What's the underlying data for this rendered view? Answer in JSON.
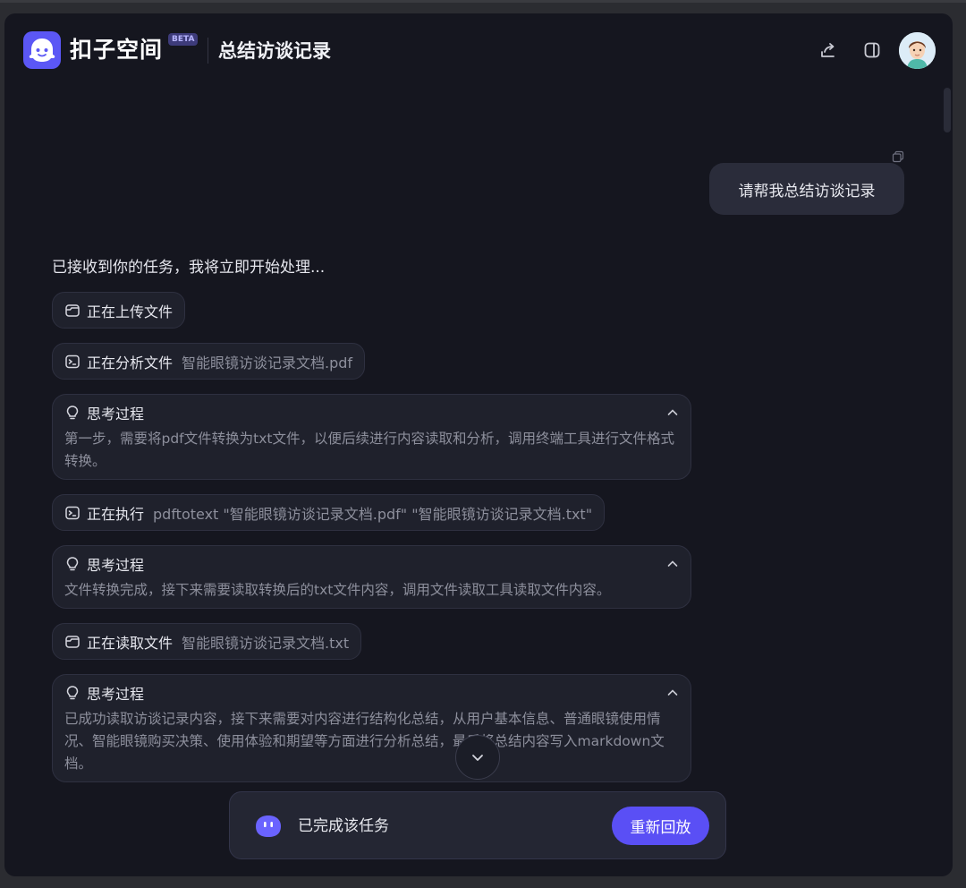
{
  "app": {
    "brand": "扣子空间",
    "badge": "BETA",
    "title": "总结访谈记录"
  },
  "header_icons": [
    "share-icon",
    "sidebar-toggle-icon",
    "avatar"
  ],
  "user_message": "请帮我总结访谈记录",
  "assistant": {
    "intro": "已接收到你的任务，我将立即开始处理...",
    "steps": [
      {
        "type": "pill",
        "icon": "folder-icon",
        "label": "正在上传文件",
        "detail": ""
      },
      {
        "type": "pill",
        "icon": "terminal-icon",
        "label": "正在分析文件",
        "detail": "智能眼镜访谈记录文档.pdf"
      },
      {
        "type": "think",
        "icon": "lightbulb-icon",
        "label": "思考过程",
        "body": "第一步，需要将pdf文件转换为txt文件，以便后续进行内容读取和分析，调用终端工具进行文件格式转换。"
      },
      {
        "type": "pill",
        "icon": "terminal-icon",
        "label": "正在执行",
        "detail": "pdftotext \"智能眼镜访谈记录文档.pdf\" \"智能眼镜访谈记录文档.txt\""
      },
      {
        "type": "think",
        "icon": "lightbulb-icon",
        "label": "思考过程",
        "body": "文件转换完成，接下来需要读取转换后的txt文件内容，调用文件读取工具读取文件内容。"
      },
      {
        "type": "pill",
        "icon": "folder-icon",
        "label": "正在读取文件",
        "detail": "智能眼镜访谈记录文档.txt"
      },
      {
        "type": "think",
        "icon": "lightbulb-icon",
        "label": "思考过程",
        "body": "已成功读取访谈记录内容，接下来需要对内容进行结构化总结，从用户基本信息、普通眼镜使用情况、智能眼镜购买决策、使用体验和期望等方面进行分析总结，最后将总结内容写入markdown文档。"
      }
    ]
  },
  "footer": {
    "status": "已完成该任务",
    "replay_label": "重新回放"
  },
  "colors": {
    "accent": "#5a4ff5",
    "background": "#15161f",
    "card": "#1f212c",
    "muted_text": "#8d8f9c"
  }
}
